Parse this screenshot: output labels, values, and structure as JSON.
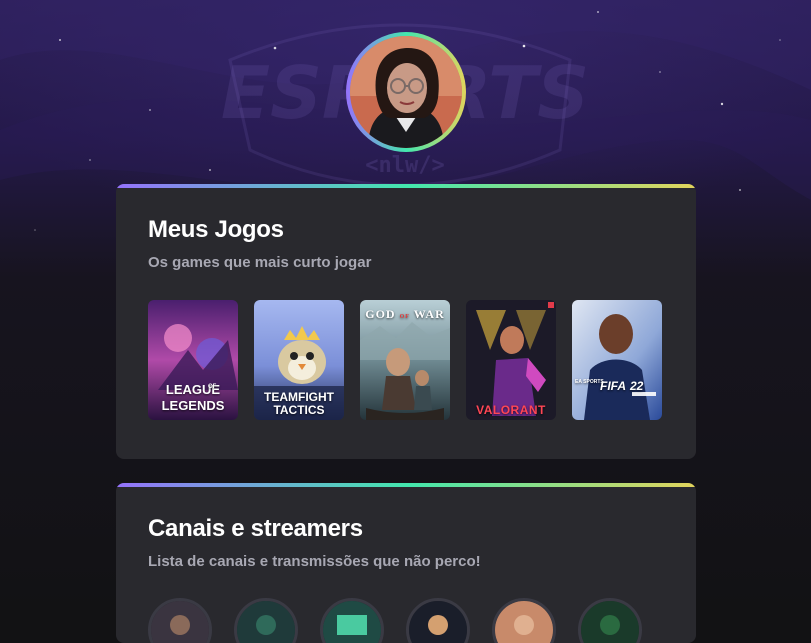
{
  "profile": {
    "avatar_icon": "profile-photo"
  },
  "background": {
    "logo_text": "ESPORTS",
    "logo_sub": "<nlw/>"
  },
  "games_section": {
    "title": "Meus Jogos",
    "subtitle": "Os games que mais curto jogar",
    "games": [
      {
        "name": "League of Legends",
        "line1": "LEAGUE",
        "of": "OF",
        "line2": "LEGENDS"
      },
      {
        "name": "Teamfight Tactics",
        "line1": "TEAMFIGHT",
        "line2": "TACTICS"
      },
      {
        "name": "God of War",
        "line1": "GOD",
        "of": "OF",
        "line2": "WAR"
      },
      {
        "name": "Valorant",
        "line1": "VALORANT"
      },
      {
        "name": "FIFA 22",
        "brand": "EA SPORTS",
        "line1": "FIFA",
        "line2": "22"
      }
    ]
  },
  "streamers_section": {
    "title": "Canais e streamers",
    "subtitle": "Lista de canais e transmissões que não perco!",
    "count": 6
  },
  "colors": {
    "page_bg": "#121214",
    "card_bg": "#29292e",
    "gradient": [
      "#9572FC",
      "#43E7AD",
      "#E2D45C"
    ],
    "title": "#ffffff",
    "subtitle": "#a8a8b3"
  }
}
